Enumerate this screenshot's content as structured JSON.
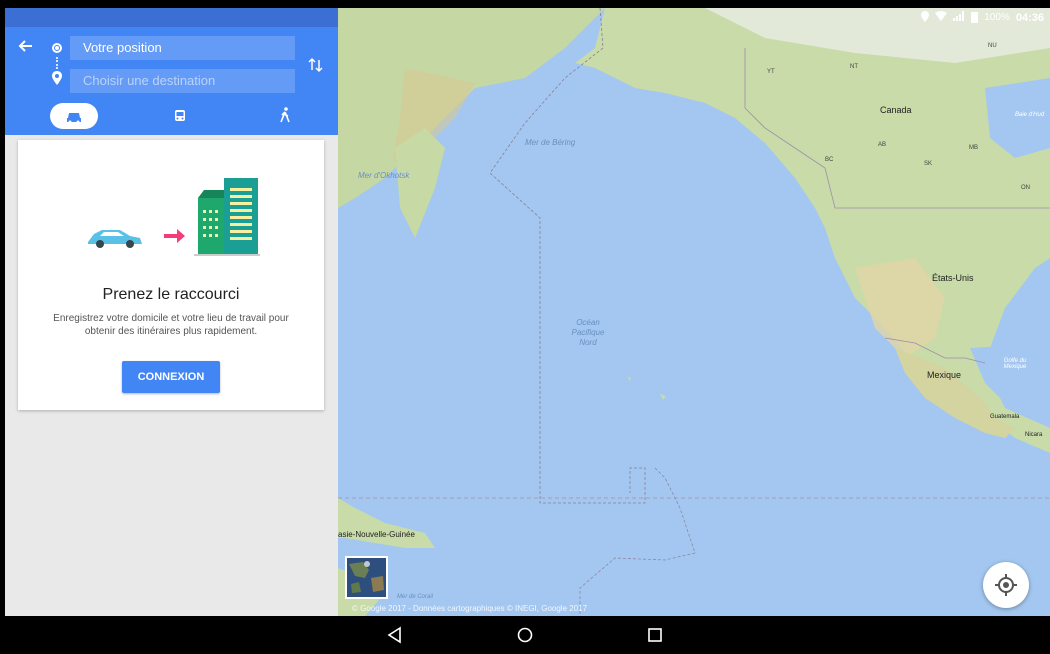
{
  "status_bar": {
    "battery": "100%",
    "time": "04:36"
  },
  "directions": {
    "origin_value": "Votre position",
    "destination_placeholder": "Choisir une destination",
    "modes": [
      "car-icon",
      "transit-icon",
      "walk-icon"
    ],
    "selected_mode": "car"
  },
  "card": {
    "title": "Prenez le raccourci",
    "text": "Enregistrez votre domicile et votre lieu de travail pour obtenir des itinéraires plus rapidement.",
    "button_label": "CONNEXION"
  },
  "map": {
    "labels": {
      "canada": "Canada",
      "etats_unis": "États-Unis",
      "mexique": "Mexique",
      "ocean": "Océan Pacifique Nord",
      "mer_bering": "Mer de Béring",
      "mer_okhotsk": "Mer d'Okhotsk",
      "golfe_mexique": "Golfe du Mexique",
      "baie_hudson": "Baie d'Hud",
      "guatemala": "Guatemala",
      "nicaragua": "Nicara",
      "papouasie": "asie-Nouvelle-Guinée",
      "mer_corail": "Mer de Corail",
      "nu": "NU",
      "nt": "NT",
      "yt": "YT",
      "ab": "AB",
      "bc": "BC",
      "sk": "SK",
      "mb": "MB",
      "on": "ON"
    },
    "copyright": "© Google 2017 - Données cartographiques © INEGI, Google 2017"
  },
  "colors": {
    "accent": "#4285f4",
    "status_bar": "#3b6fd3",
    "water": "#a3c7f0",
    "land": "#c8dba8"
  }
}
